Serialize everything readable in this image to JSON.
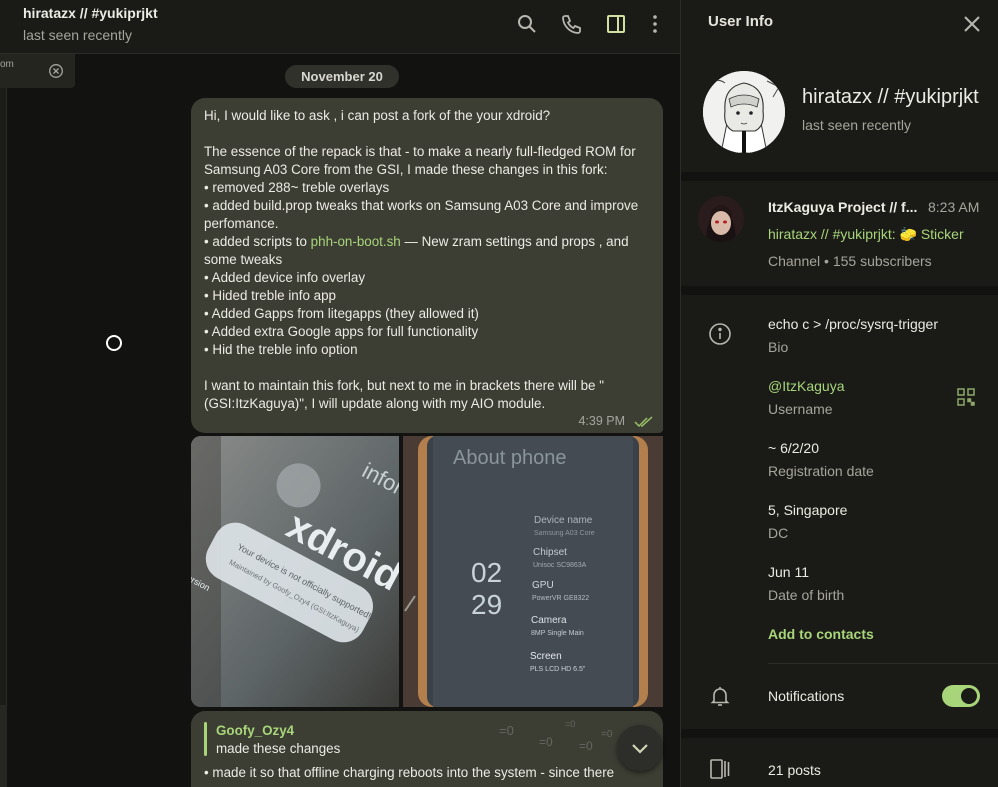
{
  "chat": {
    "title": "hiratazx // #yukiprjkt",
    "status": "last seen recently",
    "side_popup_text": "om",
    "date_pill": "November 20",
    "message1": {
      "p1": "Hi, I would like to ask , i can post a fork of the your xdroid?",
      "p2": "The essence of the repack is that - to make a nearly full-fledged ROM for Samsung A03 Core from the GSI, I made these changes in this fork:",
      "bullets": [
        "• removed 288~ treble overlays",
        "• added build.prop tweaks that works on Samsung A03 Core and improve perfomance.",
        "• added scripts to ",
        "• Added device info overlay",
        "• Hided treble info app",
        "• Added Gapps from litegapps (they allowed it)",
        "• Added extra Google apps for full functionality",
        "• Hid the treble info option"
      ],
      "link": "phh-on-boot.sh",
      "link_after": " — New zram settings and props , and some tweaks",
      "p3": "I want to maintain this fork, but next to me in brackets there will be \"(GSI:ItzKaguya)\", I will update along with my AIO module.",
      "time": "4:39 PM"
    },
    "photo1": {
      "text1": "xdroid",
      "text2": "Your device is not officially supported!",
      "text3": "Maintained by Goofy_Ozy4 (GSI:ItzKaguya)",
      "text4": "are version",
      "text5": "informatio"
    },
    "photo2": {
      "title": "About phone",
      "clock_h": "02",
      "clock_m": "29",
      "rows": [
        {
          "label": "Device name",
          "value": "Samsung A03 Core"
        },
        {
          "label": "Chipset",
          "value": "Unisoc SC9863A"
        },
        {
          "label": "GPU",
          "value": "PowerVR GE8322"
        },
        {
          "label": "Camera",
          "value": "8MP Single Main"
        },
        {
          "label": "Screen",
          "value": "PLS LCD HD 6.5\""
        }
      ]
    },
    "message2": {
      "author": "Goofy_Ozy4",
      "quoted": "made these changes",
      "body": "• made it so that offline charging reboots into the system - since there",
      "stickers": [
        "=0",
        "=0",
        "=0",
        "=0",
        "=0"
      ]
    }
  },
  "panel": {
    "title": "User Info",
    "name": "hiratazx // #yukiprjkt",
    "status": "last seen recently",
    "channel": {
      "title": "ItzKaguya Project // f...",
      "time": "8:23 AM",
      "preview_sender": "hiratazx // #yukiprjkt:",
      "preview_sticker": "🧽",
      "preview_text": "Sticker",
      "meta": "Channel • 155 subscribers"
    },
    "bio_value": "echo c > /proc/sysrq-trigger",
    "bio_label": "Bio",
    "username_value": "@ItzKaguya",
    "username_label": "Username",
    "reg_value": "~ 6/2/20",
    "reg_label": "Registration date",
    "dc_value": "5, Singapore",
    "dc_label": "DC",
    "birth_value": "Jun 11",
    "birth_label": "Date of birth",
    "add_contacts": "Add to contacts",
    "notifications_label": "Notifications",
    "notifications_on": true,
    "posts_label": "21 posts"
  },
  "colors": {
    "accent": "#a8d57a",
    "bubble": "#3c3e34",
    "panel_bg": "#1a1b17",
    "chat_bg": "#121310"
  }
}
